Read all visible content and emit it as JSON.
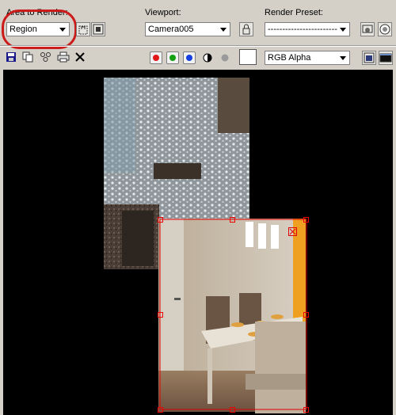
{
  "toolbar": {
    "area_label": "Area to Render:",
    "area_value": "Region",
    "viewport_label": "Viewport:",
    "viewport_value": "Camera005",
    "preset_label": "Render Preset:",
    "preset_value": "------------------------",
    "channel_value": "RGB Alpha"
  },
  "icons": {
    "area_buttons": [
      "region-lock-icon",
      "region-fit-icon"
    ],
    "viewport_lock": "padlock-icon",
    "preset_buttons": [
      "render-setup-icon",
      "render-teapot-icon"
    ],
    "file_tools": [
      "save-icon",
      "copy-icon",
      "clone-icon",
      "print-icon",
      "clear-icon"
    ],
    "channels": [
      {
        "name": "red-channel-icon",
        "color": "#e01818"
      },
      {
        "name": "green-channel-icon",
        "color": "#13a013"
      },
      {
        "name": "blue-channel-icon",
        "color": "#1640e0"
      }
    ],
    "misc": [
      "alpha-channel-icon",
      "monochrome-icon",
      "swatch-icon",
      "toggle-ui-overlay-icon",
      "toggle-ui-icon"
    ]
  },
  "colors": {
    "region_frame": "#e00000",
    "annotation": "#cc1b1b",
    "accent_wall": "#f0a020"
  }
}
